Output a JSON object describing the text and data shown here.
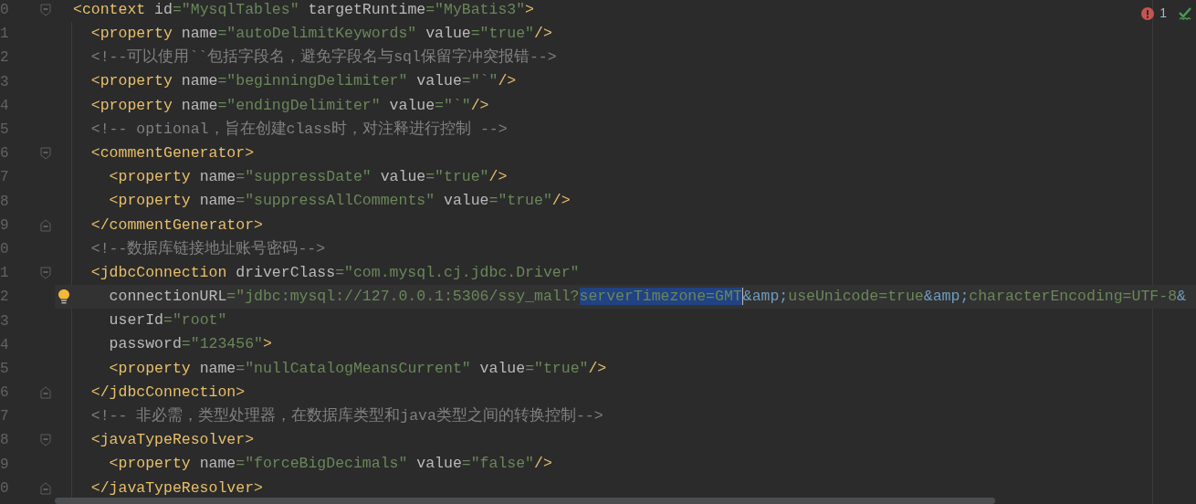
{
  "inspections": {
    "errors": "1"
  },
  "lines": [
    {
      "number": "0",
      "kind": "fold_start",
      "current": false,
      "tokens": [
        {
          "kind": "tag",
          "text": "<context"
        },
        {
          "kind": "attr",
          "text": " id"
        },
        {
          "kind": "value",
          "text": "=\"MysqlTables\""
        },
        {
          "kind": "attr",
          "text": " targetRuntime"
        },
        {
          "kind": "value",
          "text": "=\"MyBatis3\""
        },
        {
          "kind": "tag",
          "text": ">"
        }
      ]
    },
    {
      "number": "1",
      "current": false,
      "tokens": [
        {
          "kind": "tag",
          "text": "  <property"
        },
        {
          "kind": "attr",
          "text": " name"
        },
        {
          "kind": "value",
          "text": "=\"autoDelimitKeywords\""
        },
        {
          "kind": "attr",
          "text": " value"
        },
        {
          "kind": "value",
          "text": "=\"true\""
        },
        {
          "kind": "tag",
          "text": "/>"
        }
      ]
    },
    {
      "number": "2",
      "current": false,
      "tokens": [
        {
          "kind": "comment",
          "text": "  <!--可以使用``包括字段名，避免字段名与sql保留字冲突报错-->"
        }
      ]
    },
    {
      "number": "3",
      "current": false,
      "tokens": [
        {
          "kind": "tag",
          "text": "  <property"
        },
        {
          "kind": "attr",
          "text": " name"
        },
        {
          "kind": "value",
          "text": "=\"beginningDelimiter\""
        },
        {
          "kind": "attr",
          "text": " value"
        },
        {
          "kind": "value",
          "text": "=\"`\""
        },
        {
          "kind": "tag",
          "text": "/>"
        }
      ]
    },
    {
      "number": "4",
      "current": false,
      "tokens": [
        {
          "kind": "tag",
          "text": "  <property"
        },
        {
          "kind": "attr",
          "text": " name"
        },
        {
          "kind": "value",
          "text": "=\"endingDelimiter\""
        },
        {
          "kind": "attr",
          "text": " value"
        },
        {
          "kind": "value",
          "text": "=\"`\""
        },
        {
          "kind": "tag",
          "text": "/>"
        }
      ]
    },
    {
      "number": "5",
      "current": false,
      "tokens": [
        {
          "kind": "comment",
          "text": "  <!-- optional，旨在创建class时，对注释进行控制 -->"
        }
      ]
    },
    {
      "number": "6",
      "kind": "fold_start",
      "current": false,
      "tokens": [
        {
          "kind": "tag",
          "text": "  <commentGenerator>"
        }
      ]
    },
    {
      "number": "7",
      "current": false,
      "tokens": [
        {
          "kind": "tag",
          "text": "    <property"
        },
        {
          "kind": "attr",
          "text": " name"
        },
        {
          "kind": "value",
          "text": "=\"suppressDate\""
        },
        {
          "kind": "attr",
          "text": " value"
        },
        {
          "kind": "value",
          "text": "=\"true\""
        },
        {
          "kind": "tag",
          "text": "/>"
        }
      ]
    },
    {
      "number": "8",
      "current": false,
      "tokens": [
        {
          "kind": "tag",
          "text": "    <property"
        },
        {
          "kind": "attr",
          "text": " name"
        },
        {
          "kind": "value",
          "text": "=\"suppressAllComments\""
        },
        {
          "kind": "attr",
          "text": " value"
        },
        {
          "kind": "value",
          "text": "=\"true\""
        },
        {
          "kind": "tag",
          "text": "/>"
        }
      ]
    },
    {
      "number": "9",
      "kind": "fold_end",
      "current": false,
      "tokens": [
        {
          "kind": "tag",
          "text": "  </commentGenerator>"
        }
      ]
    },
    {
      "number": "0",
      "current": false,
      "tokens": [
        {
          "kind": "comment",
          "text": "  <!--数据库链接地址账号密码-->"
        }
      ]
    },
    {
      "number": "1",
      "kind": "fold_start",
      "current": false,
      "tokens": [
        {
          "kind": "tag",
          "text": "  <jdbcConnection"
        },
        {
          "kind": "attr",
          "text": " driverClass"
        },
        {
          "kind": "value",
          "text": "=\"com.mysql.cj.jdbc.Driver\""
        }
      ]
    },
    {
      "number": "2",
      "current": true,
      "tokens": [
        {
          "kind": "attr",
          "text": "    connectionURL"
        },
        {
          "kind": "value",
          "text": "=\"jdbc:mysql://127.0.0.1:5306/ssy_mall?"
        },
        {
          "kind": "selection",
          "text": "serverTimezone=GMT"
        },
        {
          "kind": "entity",
          "text": "&amp;"
        },
        {
          "kind": "value",
          "text": "useUnicode=true"
        },
        {
          "kind": "entity",
          "text": "&amp;"
        },
        {
          "kind": "value",
          "text": "characterEncoding=UTF-8"
        },
        {
          "kind": "entity",
          "text": "&"
        }
      ]
    },
    {
      "number": "3",
      "current": false,
      "tokens": [
        {
          "kind": "attr",
          "text": "    userId"
        },
        {
          "kind": "value",
          "text": "=\"root\""
        }
      ]
    },
    {
      "number": "4",
      "current": false,
      "tokens": [
        {
          "kind": "attr",
          "text": "    password"
        },
        {
          "kind": "value",
          "text": "=\"123456\""
        },
        {
          "kind": "tag",
          "text": ">"
        }
      ]
    },
    {
      "number": "5",
      "current": false,
      "tokens": [
        {
          "kind": "tag",
          "text": "    <property"
        },
        {
          "kind": "attr",
          "text": " name"
        },
        {
          "kind": "value",
          "text": "=\"nullCatalogMeansCurrent\""
        },
        {
          "kind": "attr",
          "text": " value"
        },
        {
          "kind": "value",
          "text": "=\"true\""
        },
        {
          "kind": "tag",
          "text": "/>"
        }
      ]
    },
    {
      "number": "6",
      "kind": "fold_end",
      "current": false,
      "tokens": [
        {
          "kind": "tag",
          "text": "  </jdbcConnection>"
        }
      ]
    },
    {
      "number": "7",
      "current": false,
      "tokens": [
        {
          "kind": "comment",
          "text": "  <!-- 非必需，类型处理器，在数据库类型和java类型之间的转换控制-->"
        }
      ]
    },
    {
      "number": "8",
      "kind": "fold_start",
      "current": false,
      "tokens": [
        {
          "kind": "tag",
          "text": "  <javaTypeResolver>"
        }
      ]
    },
    {
      "number": "9",
      "current": false,
      "tokens": [
        {
          "kind": "tag",
          "text": "    <property"
        },
        {
          "kind": "attr",
          "text": " name"
        },
        {
          "kind": "value",
          "text": "=\"forceBigDecimals\""
        },
        {
          "kind": "attr",
          "text": " value"
        },
        {
          "kind": "value",
          "text": "=\"false\""
        },
        {
          "kind": "tag",
          "text": "/>"
        }
      ]
    },
    {
      "number": "0",
      "kind": "fold_end",
      "current": false,
      "tokens": [
        {
          "kind": "tag",
          "text": "  </javaTypeResolver>"
        }
      ]
    }
  ]
}
